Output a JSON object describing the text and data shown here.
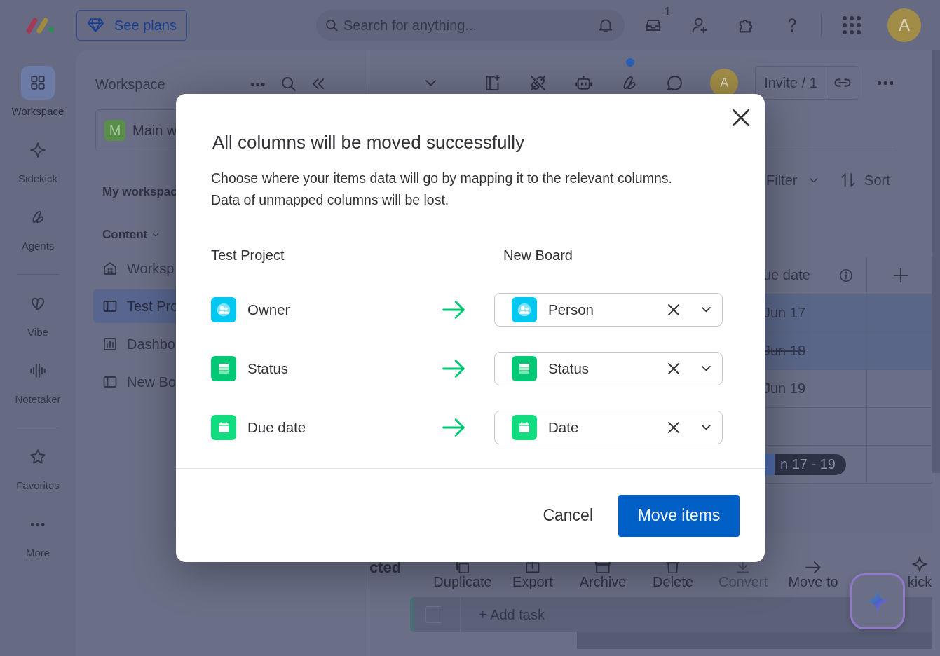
{
  "topbar": {
    "plans_button": "See plans",
    "search": {
      "placeholder": "Search for anything..."
    },
    "inbox_badge": "1",
    "avatar": "A"
  },
  "rail": {
    "groups": [
      [
        {
          "label": "Workspace",
          "kind": "workspace",
          "selected": true
        },
        {
          "label": "Sidekick",
          "kind": "sidekick",
          "selected": false
        },
        {
          "label": "Agents",
          "kind": "agents",
          "selected": false
        }
      ],
      [
        {
          "label": "Vibe",
          "kind": "vibe",
          "selected": false
        },
        {
          "label": "Notetaker",
          "kind": "notetaker",
          "selected": false
        }
      ],
      [
        {
          "label": "Favorites",
          "kind": "favorites",
          "selected": false
        },
        {
          "label": "More",
          "kind": "more",
          "selected": false
        }
      ]
    ]
  },
  "workspace_panel": {
    "title": "Workspace",
    "workspace": {
      "badge": "M",
      "name": "Main w"
    },
    "section": "My workspac",
    "content_label": "Content",
    "items": [
      {
        "label": "Worksp",
        "kind": "home",
        "selected": false
      },
      {
        "label": "Test Pro",
        "kind": "board",
        "selected": true
      },
      {
        "label": "Dashbo",
        "kind": "dashboard",
        "selected": false
      },
      {
        "label": "New Bo",
        "kind": "board",
        "selected": false
      }
    ]
  },
  "board": {
    "toolbar": {
      "avatar": "A",
      "invite": "Invite / 1",
      "notification_dot": true
    },
    "filter": "Filter",
    "sort": "Sort",
    "table": {
      "column": "ue date",
      "rows": [
        {
          "kind": "date",
          "date": "Jun 17",
          "selected": true,
          "done": false
        },
        {
          "kind": "date",
          "date": "Jun 18",
          "selected": true,
          "done": true
        },
        {
          "kind": "date",
          "date": "Jun 19",
          "selected": false,
          "done": false
        },
        {
          "kind": "empty",
          "selected": false
        },
        {
          "kind": "timeline",
          "date": "n 17 - 19",
          "selected": false
        }
      ]
    },
    "action_bar": {
      "selected_label": "cted",
      "actions": [
        {
          "label": "Duplicate",
          "kind": "duplicate",
          "disabled": false
        },
        {
          "label": "Export",
          "kind": "export",
          "disabled": false
        },
        {
          "label": "Archive",
          "kind": "archive",
          "disabled": false
        },
        {
          "label": "Delete",
          "kind": "delete",
          "disabled": false
        },
        {
          "label": "Convert",
          "kind": "convert",
          "disabled": true
        },
        {
          "label": "Move to",
          "kind": "move",
          "disabled": false
        },
        {
          "label": "kick",
          "kind": "sidekick",
          "disabled": false
        }
      ]
    },
    "add_task": {
      "label": "+ Add task",
      "checked": false
    }
  },
  "modal": {
    "title": "All columns will be moved successfully",
    "description": [
      "Choose where your items data will go by mapping it to the relevant columns.",
      "Data of unmapped columns will be lost."
    ],
    "source_heading": "Test Project",
    "target_heading": "New Board",
    "mappings": [
      {
        "source": {
          "label": "Owner",
          "kind": "people"
        },
        "target": {
          "label": "Person",
          "kind": "people"
        }
      },
      {
        "source": {
          "label": "Status",
          "kind": "status"
        },
        "target": {
          "label": "Status",
          "kind": "status"
        }
      },
      {
        "source": {
          "label": "Due date",
          "kind": "date"
        },
        "target": {
          "label": "Date",
          "kind": "date"
        }
      }
    ],
    "cancel": "Cancel",
    "confirm": "Move items"
  }
}
